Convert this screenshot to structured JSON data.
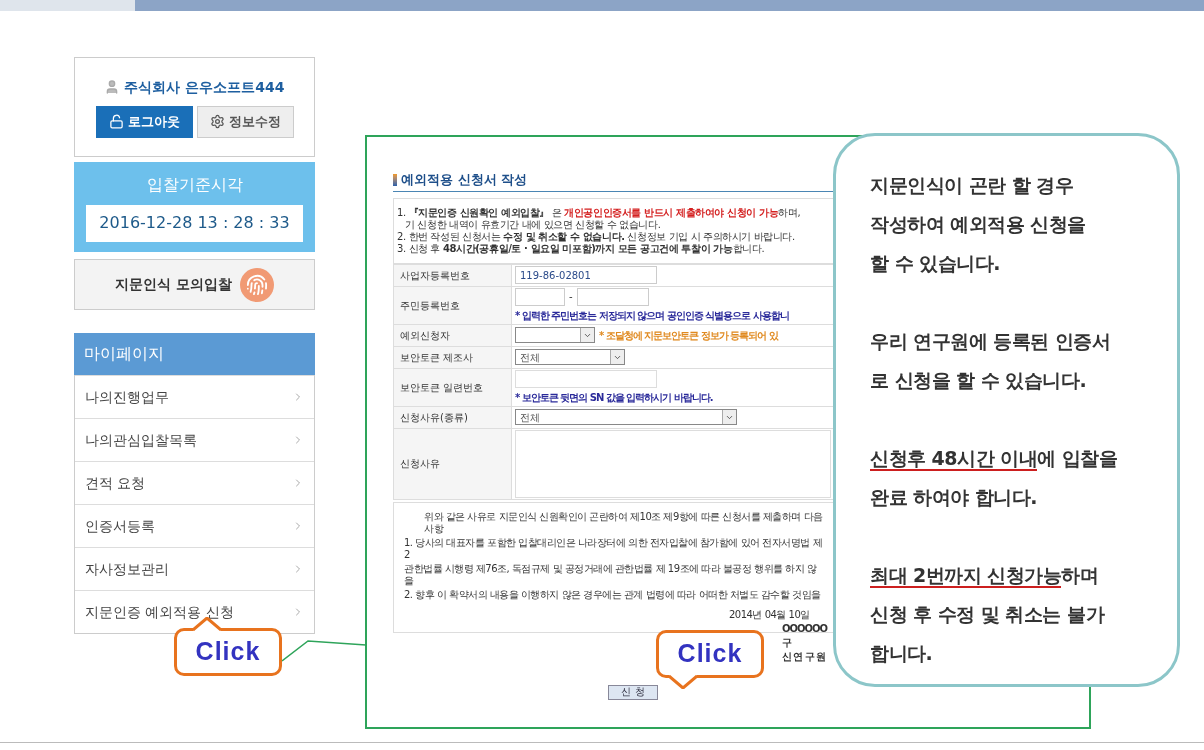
{
  "account": {
    "user": "주식회사 은우소프트444",
    "buttons": [
      {
        "label": "로그아웃",
        "kind": "logout"
      },
      {
        "label": "정보수정",
        "kind": "edit"
      }
    ]
  },
  "clock": {
    "title": "입찰기준시각",
    "time": "2016-12-28 13 : 28 : 33"
  },
  "mock_bid": {
    "label": "지문인식 모의입찰"
  },
  "menu": {
    "title": "마이페이지",
    "items": [
      {
        "label": "나의진행업무"
      },
      {
        "label": "나의관심입찰목록"
      },
      {
        "label": "견적 요청"
      },
      {
        "label": "인증서등록"
      },
      {
        "label": "자사정보관리"
      },
      {
        "label": "지문인증 예외적용 신청"
      }
    ]
  },
  "form": {
    "title": "예외적용 신청서 작성",
    "notices": [
      {
        "segments": [
          {
            "text": "1. ",
            "kind": "plain"
          },
          {
            "text": "『지문인증 신원확인 예외입찰』",
            "kind": "bold"
          },
          {
            "text": " 은 ",
            "kind": "plain"
          },
          {
            "text": "개인공인인증서를 반드시 제출하여야 신청이 가능",
            "kind": "red"
          },
          {
            "text": "하며,",
            "kind": "plain"
          }
        ]
      },
      {
        "segments": [
          {
            "text": "기 신청한 내역이 유효기간 내에 있으면 신청할 수 없습니다.",
            "kind": "plain"
          }
        ],
        "indent": true
      },
      {
        "segments": [
          {
            "text": "2. 한번 작성된 신청서는 ",
            "kind": "plain"
          },
          {
            "text": "수정 및 취소할 수 없습니다.",
            "kind": "bold"
          },
          {
            "text": " 신청정보 기입 시 주의하시기 바랍니다.",
            "kind": "plain"
          }
        ]
      },
      {
        "segments": [
          {
            "text": "3. 신청 후 ",
            "kind": "plain"
          },
          {
            "text": "48시간(공휴일/토 · 일요일 미포함)까지 모든 공고건에 투찰이 가능",
            "kind": "bold"
          },
          {
            "text": "합니다.",
            "kind": "plain"
          }
        ]
      }
    ],
    "rows": [
      {
        "label": "사업자등록번호",
        "kind": "input",
        "value": "119-86-02801"
      },
      {
        "label": "주민등록번호",
        "kind": "split",
        "separator": "-",
        "note": "* 입력한 주민번호는 저장되지 않으며 공인인증 식별용으로 사용합니",
        "color": "#2a2a9a"
      },
      {
        "label": "예외신청자",
        "kind": "select_note",
        "note": "* 조달청에 지문보안토큰 정보가 등록되어 있",
        "color": "#e08a20"
      },
      {
        "label": "보안토큰 제조사",
        "kind": "select",
        "value": "전체"
      },
      {
        "label": "보안토큰 일련번호",
        "kind": "input_note",
        "note": "* 보안토큰 뒷면의 SN 값을 입력하시기 바랍니다.",
        "color": "#2a2a9a"
      },
      {
        "label": "신청사유(종류)",
        "kind": "select_wide",
        "value": "전체"
      },
      {
        "label": "신청사유",
        "kind": "textarea"
      }
    ],
    "declaration": {
      "intro": "위와 같은 사유로 지문인식 신원확인이 곤란하여 제10조 제9항에 따른 신청서를 제출하며 다음 사항",
      "items": [
        "1. 당사의 대표자를 포함한 입찰대리인은 나라장터에 의한 전자입찰에 참가함에 있어 전자서명법 제2",
        "관한법률 시행령 제76조, 독점규제 및 공정거래에 관한법률 제 19조에 따라 불공정 행위를 하지 않을",
        "2. 향후 이 확약서의 내용을 이행하지 않은 경우에는 관계 법령에 따라 어떠한 처벌도 감수할 것임을"
      ],
      "date": "2014년 04월 10일",
      "signature": [
        "OOOOOO",
        "구",
        "신 연 구 원"
      ]
    },
    "submit": "신 청"
  },
  "callouts": [
    {
      "text": "Click"
    },
    {
      "text": "Click"
    }
  ],
  "info": {
    "paragraphs": [
      [
        [
          {
            "text": "지문인식이 곤란 할 경우",
            "underlined": false
          }
        ],
        [
          {
            "text": "작성하여 예외적용 신청을",
            "underlined": false
          }
        ],
        [
          {
            "text": "할 수 있습니다.",
            "underlined": false
          }
        ]
      ],
      [
        [
          {
            "text": "우리 연구원에 등록된 인증서",
            "underlined": false
          }
        ],
        [
          {
            "text": "로 신청을 할 수 있습니다.",
            "underlined": false
          }
        ]
      ],
      [
        [
          {
            "text": "신청후 48시간 이내",
            "underlined": true
          },
          {
            "text": "에 입찰을",
            "underlined": false
          }
        ],
        [
          {
            "text": "완료 하여야 합니다.",
            "underlined": false
          }
        ]
      ],
      [
        [
          {
            "text": "최대 2번까지 신청가능",
            "underlined": true
          },
          {
            "text": "하며",
            "underlined": false
          }
        ],
        [
          {
            "text": "신청 후 수정 및 취소는 불가",
            "underlined": false
          }
        ],
        [
          {
            "text": "합니다.",
            "underlined": false
          }
        ]
      ]
    ]
  }
}
